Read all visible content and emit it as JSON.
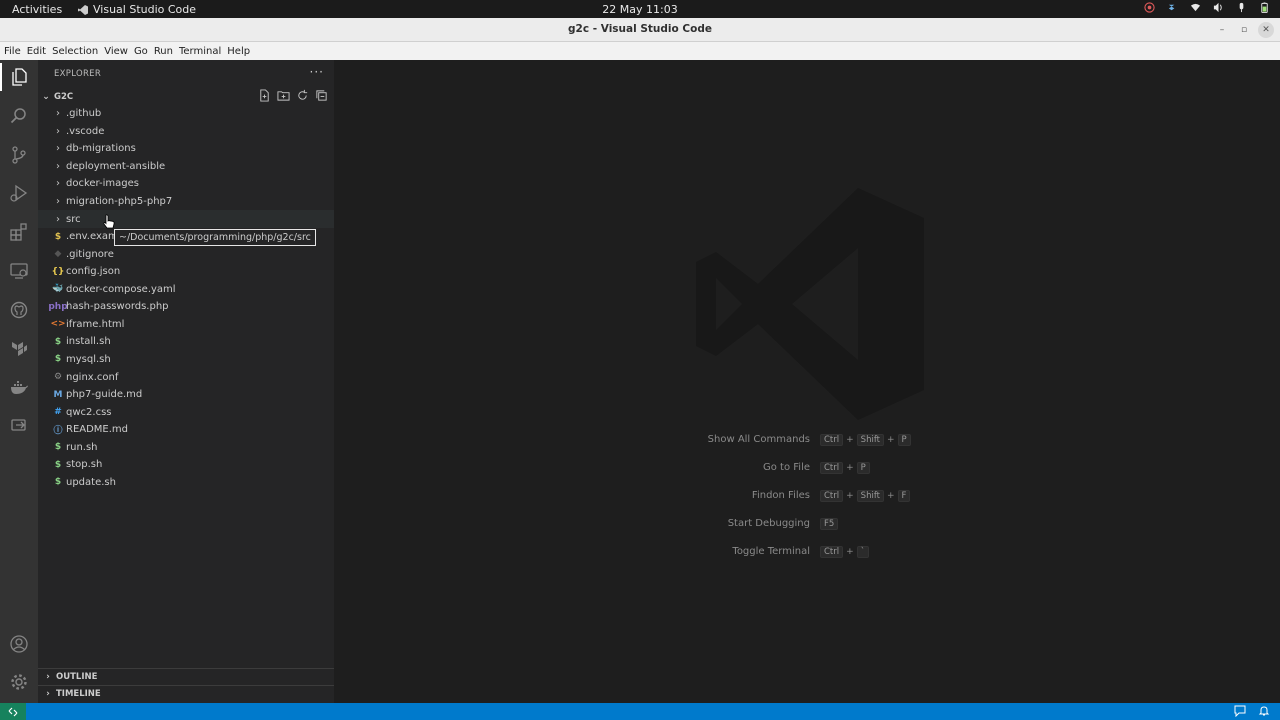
{
  "topbar": {
    "activities": "Activities",
    "app_name": "Visual Studio Code",
    "clock": "22 May  11:03",
    "tray_icons": [
      "chrome-icon",
      "dropbox-icon",
      "wifi-icon",
      "volume-icon",
      "microphone-icon",
      "battery-icon"
    ]
  },
  "window": {
    "title": "g2c - Visual Studio Code",
    "controls": [
      "minimize",
      "maximize",
      "close"
    ]
  },
  "menu": {
    "items": [
      "File",
      "Edit",
      "Selection",
      "View",
      "Go",
      "Run",
      "Terminal",
      "Help"
    ]
  },
  "activity_bar": {
    "top": [
      "explorer-icon",
      "search-icon",
      "source-control-icon",
      "run-debug-icon",
      "extensions-icon",
      "remote-explorer-icon",
      "github-icon",
      "terraform-icon",
      "docker-icon",
      "live-share-icon"
    ],
    "bottom": [
      "accounts-icon",
      "manage-gear-icon"
    ]
  },
  "explorer": {
    "header": "EXPLORER",
    "more": "···",
    "folder": "G2C",
    "tree": [
      {
        "label": ".github",
        "kind": "folder"
      },
      {
        "label": ".vscode",
        "kind": "folder"
      },
      {
        "label": "db-migrations",
        "kind": "folder"
      },
      {
        "label": "deployment-ansible",
        "kind": "folder"
      },
      {
        "label": "docker-images",
        "kind": "folder"
      },
      {
        "label": "migration-php5-php7",
        "kind": "folder"
      },
      {
        "label": "src",
        "kind": "folder"
      },
      {
        "label": ".env.exam",
        "kind": "file",
        "icon": "$",
        "color": "#e0c050"
      },
      {
        "label": ".gitignore",
        "kind": "file",
        "icon": "◆",
        "color": "#555555"
      },
      {
        "label": "config.json",
        "kind": "file",
        "icon": "{}",
        "color": "#e6c84f"
      },
      {
        "label": "docker-compose.yaml",
        "kind": "file",
        "icon": "🐳",
        "color": "#e24c7a"
      },
      {
        "label": "hash-passwords.php",
        "kind": "file",
        "icon": "php",
        "color": "#8a70c8"
      },
      {
        "label": "iframe.html",
        "kind": "file",
        "icon": "<>",
        "color": "#e37933"
      },
      {
        "label": "install.sh",
        "kind": "file",
        "icon": "$",
        "color": "#89d185"
      },
      {
        "label": "mysql.sh",
        "kind": "file",
        "icon": "$",
        "color": "#89d185"
      },
      {
        "label": "nginx.conf",
        "kind": "file",
        "icon": "⚙",
        "color": "#8a8a8a"
      },
      {
        "label": "php7-guide.md",
        "kind": "file",
        "icon": "M",
        "color": "#6aa7e0"
      },
      {
        "label": "qwc2.css",
        "kind": "file",
        "icon": "#",
        "color": "#42a5f5"
      },
      {
        "label": "README.md",
        "kind": "file",
        "icon": "ⓘ",
        "color": "#6aa7e0"
      },
      {
        "label": "run.sh",
        "kind": "file",
        "icon": "$",
        "color": "#89d185"
      },
      {
        "label": "stop.sh",
        "kind": "file",
        "icon": "$",
        "color": "#89d185"
      },
      {
        "label": "update.sh",
        "kind": "file",
        "icon": "$",
        "color": "#89d185"
      }
    ],
    "outline": "OUTLINE",
    "timeline": "TIMELINE"
  },
  "tooltip": "~/Documents/programming/php/g2c/src",
  "shortcuts": [
    {
      "label": "Show All Commands",
      "keys": [
        "Ctrl",
        "Shift",
        "P"
      ]
    },
    {
      "label": "Go to File",
      "keys": [
        "Ctrl",
        "P"
      ]
    },
    {
      "label": "Findon Files",
      "keys": [
        "Ctrl",
        "Shift",
        "F"
      ]
    },
    {
      "label": "Start Debugging",
      "keys": [
        "F5"
      ]
    },
    {
      "label": "Toggle Terminal",
      "keys": [
        "Ctrl",
        "`"
      ]
    }
  ],
  "colors": {
    "statusbar": "#007acc",
    "remote": "#16825d",
    "sidebar": "#252526",
    "editor": "#1e1e1e",
    "activitybar": "#333333"
  }
}
